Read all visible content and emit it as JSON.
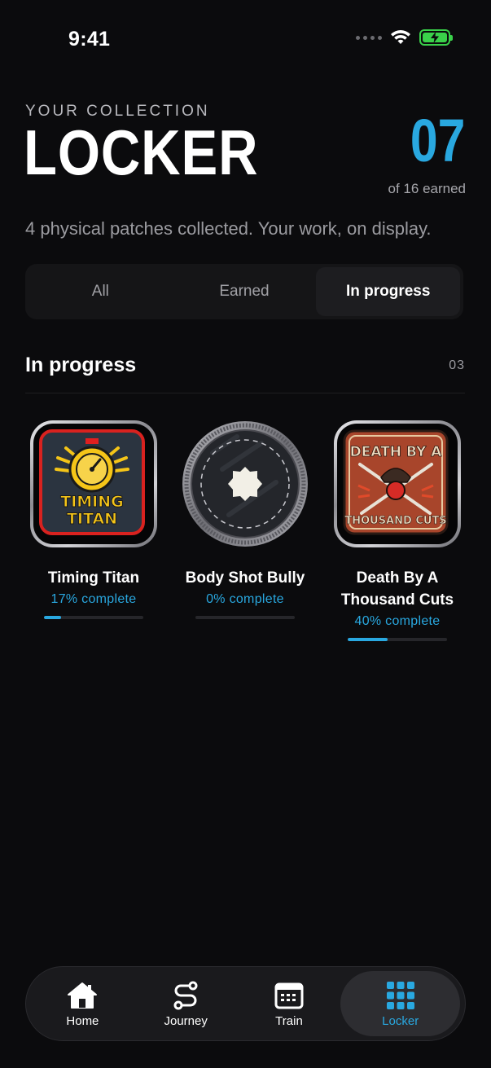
{
  "status_bar": {
    "time": "9:41"
  },
  "header": {
    "kicker": "YOUR COLLECTION",
    "title": "LOCKER",
    "earned_count": "07",
    "earned_total": "of 16 earned",
    "subtitle": "4 physical patches collected. Your work, on display."
  },
  "filters": {
    "options": [
      "All",
      "Earned",
      "In progress"
    ],
    "selected": "In progress"
  },
  "section": {
    "title": "In progress",
    "count": "03"
  },
  "patches": [
    {
      "name": "Timing Titan",
      "progress_text": "17% complete",
      "progress": 0.17,
      "art_line1": "TIMING",
      "art_line2": "TITAN"
    },
    {
      "name": "Body Shot Bully",
      "progress_text": "0% complete",
      "progress": 0.0
    },
    {
      "name": "Death By A Thousand Cuts",
      "progress_text": "40% complete",
      "progress": 0.4,
      "art_line1": "DEATH BY A",
      "art_line2": "THOUSAND CUTS"
    }
  ],
  "tabbar": {
    "items": [
      {
        "label": "Home",
        "icon": "home-icon"
      },
      {
        "label": "Journey",
        "icon": "route-icon"
      },
      {
        "label": "Train",
        "icon": "calendar-icon"
      },
      {
        "label": "Locker",
        "icon": "grid-icon"
      }
    ],
    "active": "Locker"
  },
  "colors": {
    "accent": "#29a8e0",
    "background": "#0b0b0d",
    "battery": "#3ad14a"
  }
}
